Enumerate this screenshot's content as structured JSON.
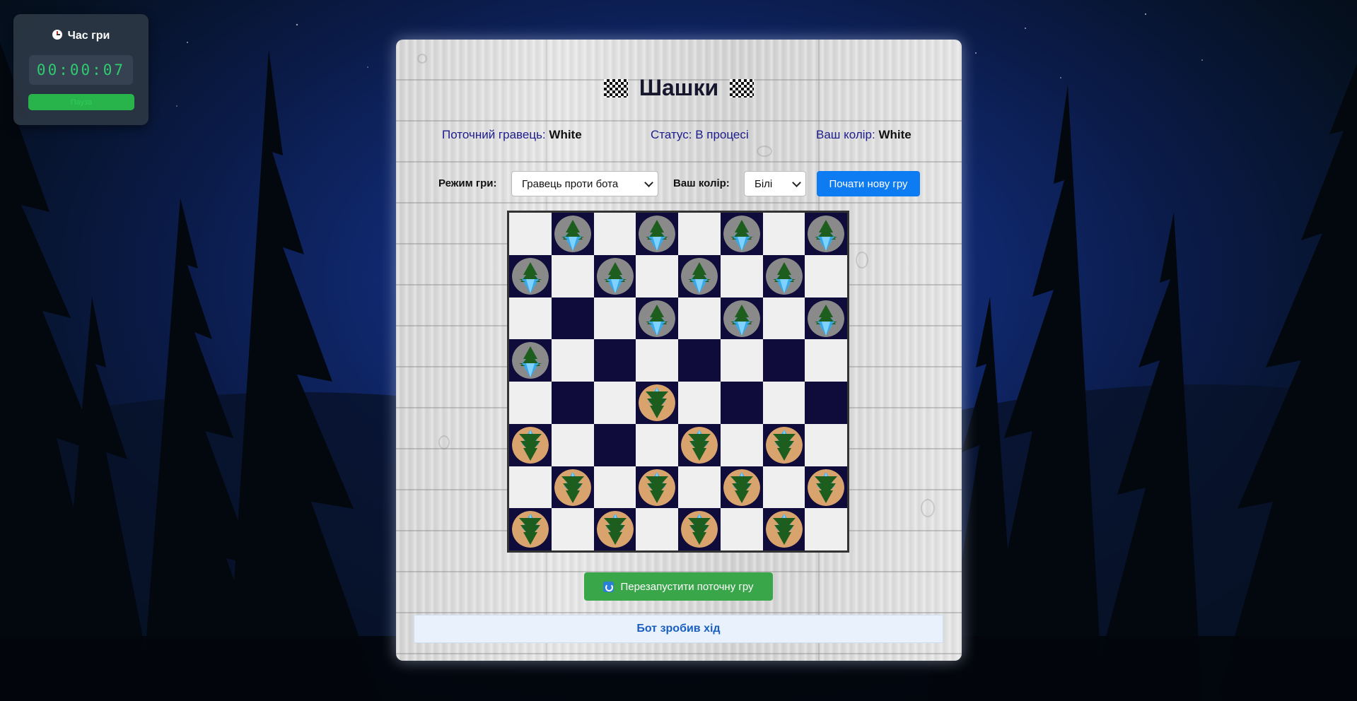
{
  "timer": {
    "title": "Час гри",
    "icon": "clock-icon",
    "time": "00:00:07",
    "button_label": "Пауза"
  },
  "game": {
    "title": "Шашки",
    "title_icon": "checkered-flag-icon",
    "current_player_label": "Поточний гравець:",
    "current_player_value": "White",
    "status_label": "Статус:",
    "status_value": "В процесі",
    "your_color_label": "Ваш колір:",
    "your_color_value": "White"
  },
  "controls": {
    "mode_label": "Режим гри:",
    "mode_selected": "Гравець проти бота",
    "color_label": "Ваш колір:",
    "color_selected": "Білі",
    "new_game_label": "Почати нову гру"
  },
  "board": {
    "rows": [
      ". g . g . g . g",
      "g . g . g . g .",
      ". . . g . g . g",
      "g . . . . . . .",
      ". . . w . . . .",
      "w . . . w . w .",
      ". w . w . w . w",
      "w . w . w . w ."
    ],
    "legend": {
      "g": "grey-piece",
      "w": "orange-piece",
      ".": "empty"
    },
    "colors": {
      "light": "#efefef",
      "dark": "#0f0b3a",
      "grey_piece": "#8a8a8a",
      "orange_piece": "#d8a36c"
    }
  },
  "restart_label": "Перезапустити поточну гру",
  "message": "Бот зробив хід"
}
